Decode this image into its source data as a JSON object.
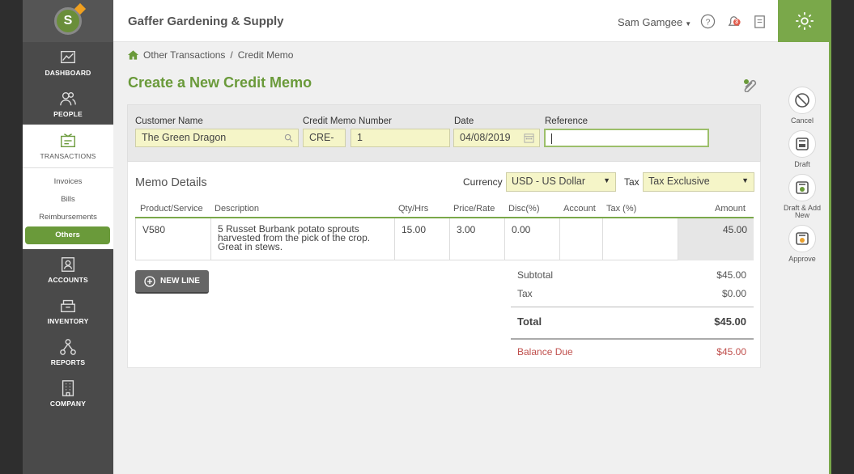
{
  "app": {
    "company": "Gaffer Gardening & Supply",
    "user": "Sam Gamgee",
    "notif_count": "3"
  },
  "sidebar": {
    "items": [
      {
        "label": "DASHBOARD"
      },
      {
        "label": "PEOPLE"
      },
      {
        "label": "TRANSACTIONS"
      },
      {
        "label": "ACCOUNTS"
      },
      {
        "label": "INVENTORY"
      },
      {
        "label": "REPORTS"
      },
      {
        "label": "COMPANY"
      }
    ],
    "sub": [
      "Invoices",
      "Bills",
      "Reimbursements",
      "Others"
    ]
  },
  "breadcrumb": {
    "parent": "Other Transactions",
    "sep": "/",
    "current": "Credit Memo"
  },
  "page": {
    "title": "Create a New Credit Memo"
  },
  "header": {
    "customer_label": "Customer Name",
    "customer_value": "The Green Dragon",
    "memo_label": "Credit Memo Number",
    "memo_prefix": "CRE-",
    "memo_number": "1",
    "date_label": "Date",
    "date_value": "04/08/2019",
    "ref_label": "Reference",
    "ref_value": ""
  },
  "details": {
    "title": "Memo Details",
    "currency_label": "Currency",
    "currency_value": "USD - US Dollar",
    "tax_label": "Tax",
    "tax_value": "Tax Exclusive",
    "columns": [
      "Product/Service",
      "Description",
      "Qty/Hrs",
      "Price/Rate",
      "Disc(%)",
      "Account",
      "Tax (%)",
      "Amount"
    ],
    "rows": [
      {
        "product": "V580",
        "description": "5 Russet Burbank potato sprouts harvested from the pick of the crop. Great in stews.",
        "qty": "15.00",
        "price": "3.00",
        "disc": "0.00",
        "account": "",
        "tax": "",
        "amount": "45.00"
      }
    ],
    "new_line_label": "NEW LINE"
  },
  "totals": {
    "subtotal_label": "Subtotal",
    "subtotal": "$45.00",
    "tax_label": "Tax",
    "tax": "$0.00",
    "total_label": "Total",
    "total": "$45.00",
    "balance_label": "Balance Due",
    "balance": "$45.00"
  },
  "actions": {
    "cancel": "Cancel",
    "draft": "Draft",
    "draft_add": "Draft & Add New",
    "approve": "Approve"
  },
  "colors": {
    "accent": "#6a9a3a",
    "balance": "#c0504d",
    "field_bg": "#f5f5c8"
  }
}
